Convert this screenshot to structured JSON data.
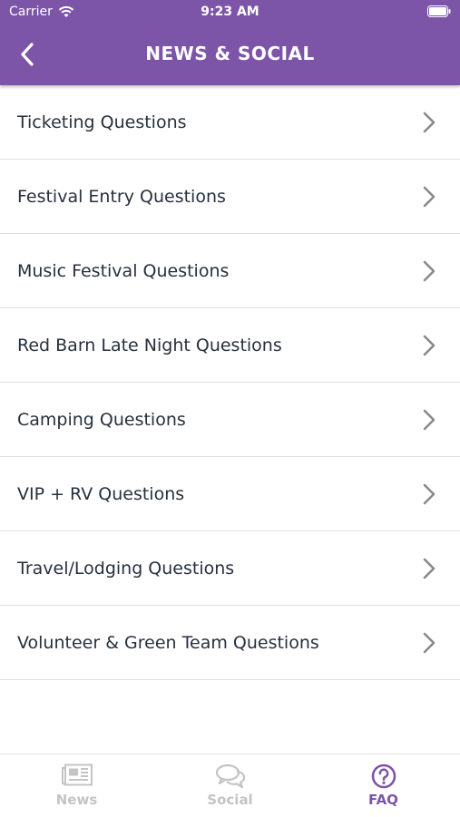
{
  "status_bar": {
    "carrier": "Carrier",
    "time": "9:23 AM"
  },
  "nav": {
    "title": "NEWS & SOCIAL",
    "back_icon": "chevron-left-icon"
  },
  "faq_items": [
    {
      "label": "Ticketing Questions"
    },
    {
      "label": "Festival Entry Questions"
    },
    {
      "label": "Music Festival Questions"
    },
    {
      "label": "Red Barn Late Night Questions"
    },
    {
      "label": "Camping Questions"
    },
    {
      "label": "VIP + RV Questions"
    },
    {
      "label": "Travel/Lodging Questions"
    },
    {
      "label": "Volunteer & Green Team Questions"
    }
  ],
  "tabs": [
    {
      "label": "News",
      "icon": "newspaper-icon",
      "active": false
    },
    {
      "label": "Social",
      "icon": "chat-bubbles-icon",
      "active": false
    },
    {
      "label": "FAQ",
      "icon": "question-circle-icon",
      "active": true
    }
  ],
  "colors": {
    "brand": "#7d55a8",
    "text": "#26303d",
    "inactive": "#c4c4c4",
    "chevron": "#8a8a8a"
  }
}
